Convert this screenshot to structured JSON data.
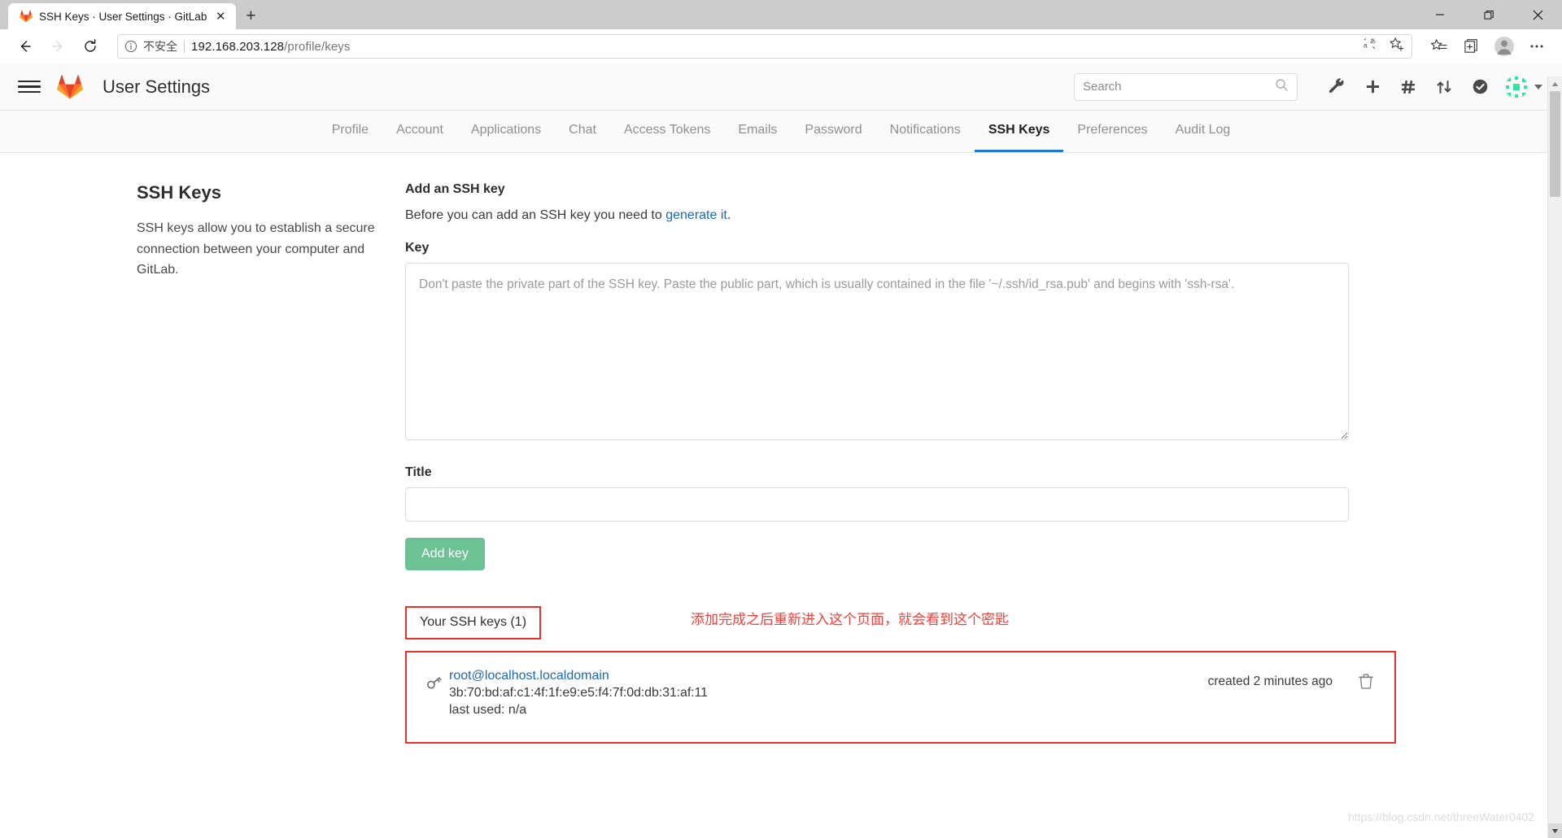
{
  "browser": {
    "tab": {
      "title": "SSH Keys · User Settings · GitLab",
      "favicon_name": "gitlab-favicon",
      "close_label": "✕"
    },
    "new_tab_label": "+",
    "window_controls": {
      "minimize": "—",
      "maximize": "❐",
      "close": "✕"
    },
    "nav": {
      "back_label": "←",
      "forward_label": "→",
      "reload_label": "⟳"
    },
    "address": {
      "security_text": "不安全",
      "url_host": "192.168.203.128",
      "url_path": "/profile/keys",
      "full_url": "192.168.203.128/profile/keys"
    },
    "toolbar_icons": [
      "translate-icon",
      "add-favorite-icon",
      "favorites-hub-icon",
      "collections-icon",
      "profile-icon",
      "more-options-icon"
    ]
  },
  "gitlab_header": {
    "menu_label": "Menu",
    "logo_name": "gitlab-logo",
    "title": "User Settings",
    "search": {
      "placeholder": "Search",
      "value": ""
    },
    "icons": [
      {
        "name": "admin-wrench-icon",
        "label": "Admin Area"
      },
      {
        "name": "new-plus-icon",
        "label": "New..."
      },
      {
        "name": "issues-hash-icon",
        "label": "Issues"
      },
      {
        "name": "merge-requests-icon",
        "label": "Merge requests"
      },
      {
        "name": "todos-check-icon",
        "label": "To-Do List"
      }
    ],
    "avatar_name": "user-avatar"
  },
  "subnav": {
    "items": [
      {
        "label": "Profile",
        "active": false
      },
      {
        "label": "Account",
        "active": false
      },
      {
        "label": "Applications",
        "active": false
      },
      {
        "label": "Chat",
        "active": false
      },
      {
        "label": "Access Tokens",
        "active": false
      },
      {
        "label": "Emails",
        "active": false
      },
      {
        "label": "Password",
        "active": false
      },
      {
        "label": "Notifications",
        "active": false
      },
      {
        "label": "SSH Keys",
        "active": true
      },
      {
        "label": "Preferences",
        "active": false
      },
      {
        "label": "Audit Log",
        "active": false
      }
    ]
  },
  "sidebar": {
    "heading": "SSH Keys",
    "description": "SSH keys allow you to establish a secure connection between your computer and GitLab."
  },
  "main": {
    "add_key_heading": "Add an SSH key",
    "before_text": "Before you can add an SSH key you need to ",
    "generate_link": "generate it",
    "before_text_end": ".",
    "key_label": "Key",
    "key_placeholder": "Don't paste the private part of the SSH key. Paste the public part, which is usually contained in the file '~/.ssh/id_rsa.pub' and begins with 'ssh-rsa'.",
    "key_value": "",
    "title_label": "Title",
    "title_placeholder": "",
    "title_value": "",
    "add_key_button": "Add key"
  },
  "keys_section": {
    "heading": "Your SSH keys (1)",
    "annotation": "添加完成之后重新进入这个页面，就会看到这个密匙",
    "annotation_color": "#f1403a",
    "highlight_color": "#e8312a",
    "rows": [
      {
        "icon_name": "key-icon",
        "title": "root@localhost.localdomain",
        "fingerprint": "3b:70:bd:af:c1:4f:1f:e9:e5:f4:7f:0d:db:31:af:11",
        "last_used": "last used: n/a",
        "created": "created 2 minutes ago",
        "delete_icon": "trash-icon"
      }
    ]
  },
  "watermark": "https://blog.csdn.net/threeWater0402",
  "colors": {
    "accent_blue": "#1f78d1",
    "link_blue": "#1b69b6",
    "button_green": "#6cc195",
    "annotation_red": "#e8312a"
  }
}
